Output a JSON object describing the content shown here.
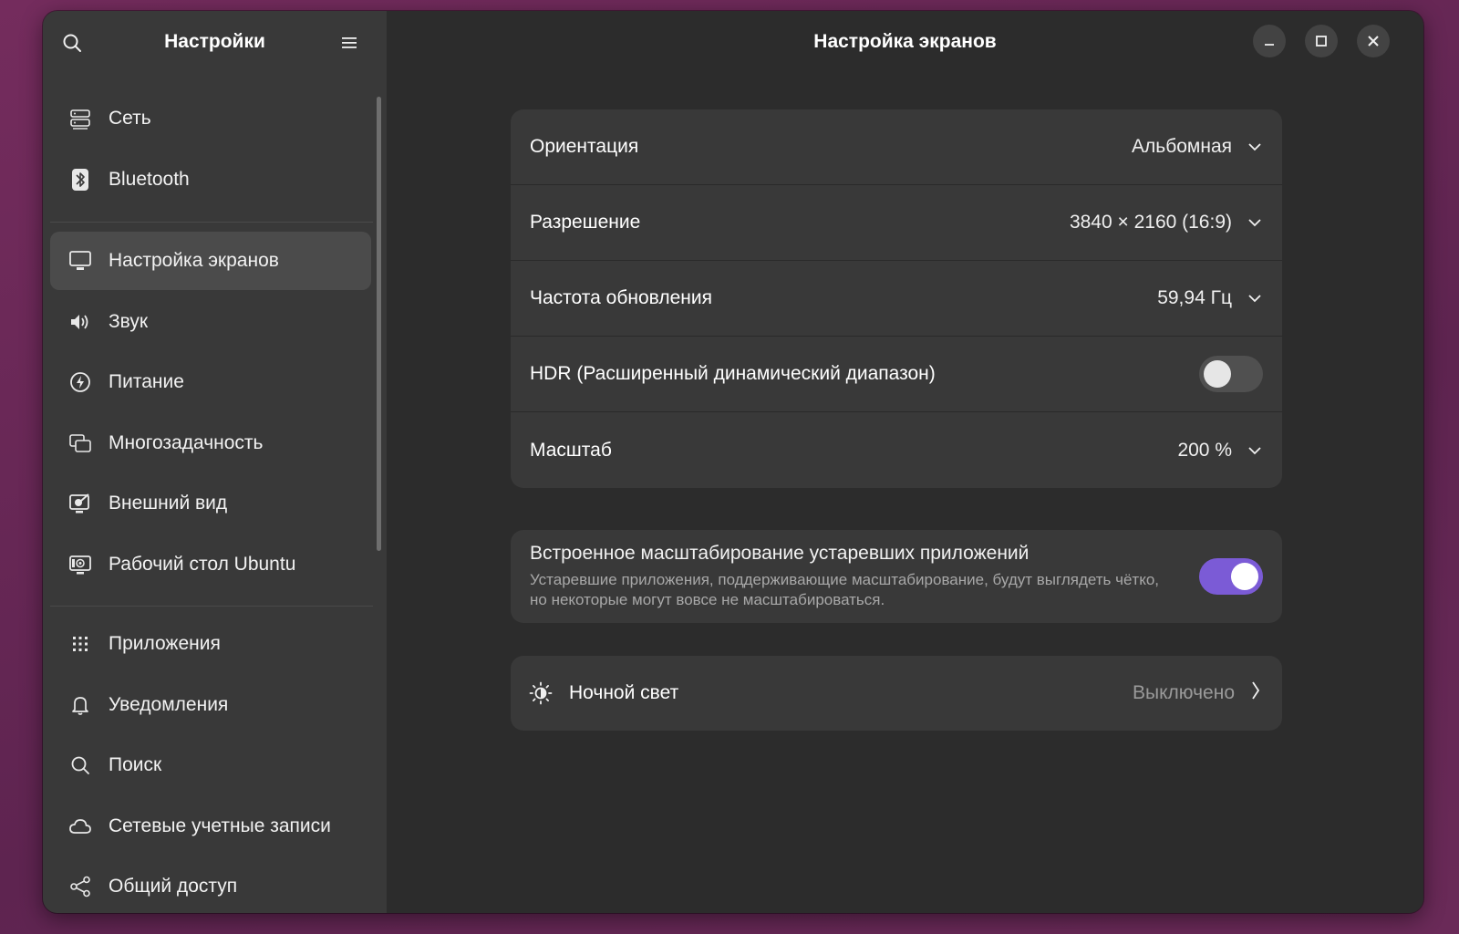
{
  "sidebar": {
    "title": "Настройки",
    "items": [
      {
        "label": "Сеть",
        "icon": "network-icon"
      },
      {
        "label": "Bluetooth",
        "icon": "bluetooth-icon"
      },
      {
        "label": "Настройка экранов",
        "icon": "display-icon",
        "active": true
      },
      {
        "label": "Звук",
        "icon": "speaker-icon"
      },
      {
        "label": "Питание",
        "icon": "power-icon"
      },
      {
        "label": "Многозадачность",
        "icon": "multitasking-icon"
      },
      {
        "label": "Внешний вид",
        "icon": "appearance-icon"
      },
      {
        "label": "Рабочий стол Ubuntu",
        "icon": "ubuntu-desktop-icon"
      },
      {
        "label": "Приложения",
        "icon": "apps-grid-icon"
      },
      {
        "label": "Уведомления",
        "icon": "bell-icon"
      },
      {
        "label": "Поиск",
        "icon": "search-icon"
      },
      {
        "label": "Сетевые учетные записи",
        "icon": "cloud-icon"
      },
      {
        "label": "Общий доступ",
        "icon": "share-icon"
      }
    ]
  },
  "main": {
    "title": "Настройка экранов",
    "display_settings": {
      "orientation": {
        "label": "Ориентация",
        "value": "Альбомная"
      },
      "resolution": {
        "label": "Разрешение",
        "value": "3840 × 2160 (16:9)"
      },
      "refresh_rate": {
        "label": "Частота обновления",
        "value": "59,94 Гц"
      },
      "hdr": {
        "label": "HDR (Расширенный динамический диапазон)",
        "enabled": false
      },
      "scale": {
        "label": "Масштаб",
        "value": "200 %"
      }
    },
    "legacy_scaling": {
      "title": "Встроенное масштабирование устаревших приложений",
      "description": "Устаревшие приложения, поддерживающие масштабирование, будут выглядеть чётко, но некоторые могут вовсе не масштабироваться.",
      "enabled": true
    },
    "night_light": {
      "label": "Ночной свет",
      "value": "Выключено"
    }
  },
  "colors": {
    "accent": "#7b5bd6",
    "sidebar_bg": "#393939",
    "content_bg": "#2c2c2c",
    "card_bg": "#393939"
  }
}
